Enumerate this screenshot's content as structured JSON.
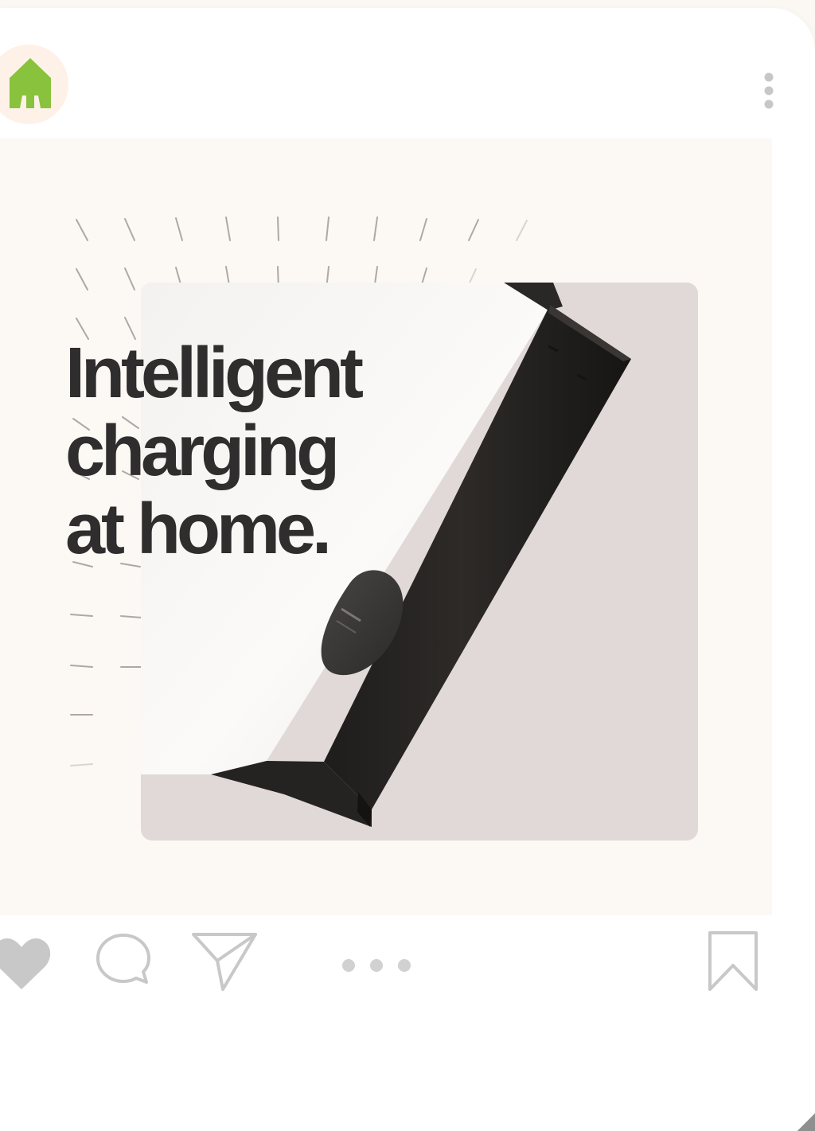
{
  "app": {
    "name": "Instagram-style post"
  },
  "header": {
    "avatar_icon": "house-logo-icon",
    "menu_icon": "vertical-ellipsis-icon"
  },
  "post": {
    "headline_lines": [
      "Intelligent",
      "charging",
      "at home."
    ]
  },
  "actions": {
    "like_icon": "heart-icon",
    "comment_icon": "speech-bubble-icon",
    "share_icon": "paper-plane-icon",
    "bookmark_icon": "bookmark-icon",
    "carousel_count": 3,
    "carousel_active": 1
  },
  "colors": {
    "background": "#fbf7f3",
    "card": "#ffffff",
    "post_background": "#fcf8f4",
    "panel": "#e1d9d7",
    "headline": "#2f2d2d",
    "logo_green": "#89c23d",
    "avatar_bg": "#fdf1e8",
    "icon_gray": "#c9c9c9"
  }
}
